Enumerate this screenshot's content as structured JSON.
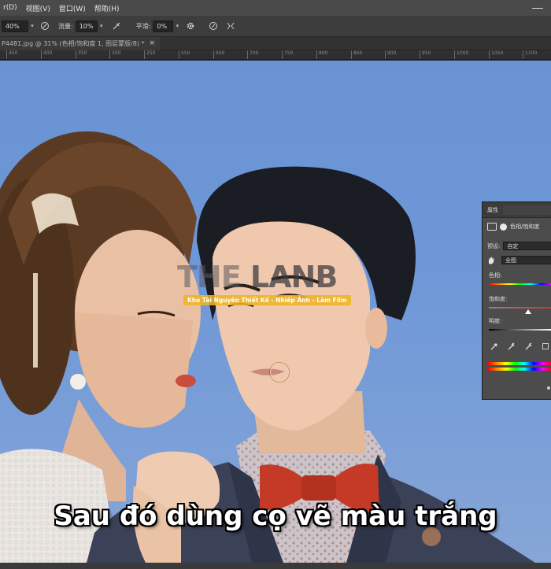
{
  "menu": {
    "items": [
      "r(D)",
      "视图(V)",
      "窗口(W)",
      "帮助(H)"
    ]
  },
  "options": {
    "size_value": "40%",
    "flow_label": "流量:",
    "flow_value": "10%",
    "smooth_label": "平滑:",
    "smooth_value": "0%"
  },
  "document": {
    "tab_title": "P4481.jpg @ 31% (色相/饱和度 1, 图层蒙版/8) *",
    "close_glyph": "×"
  },
  "ruler": {
    "ticks": [
      "450",
      "400",
      "350",
      "300",
      "250",
      "550",
      "650",
      "700",
      "750",
      "800",
      "850",
      "900",
      "950",
      "1000",
      "1050",
      "1100"
    ]
  },
  "watermark": {
    "main": "THE LANB",
    "the": "THE",
    "lanb": "LANB",
    "sub": "Kho Tài Nguyên Thiết Kế - Nhiếp Ảnh - Làm Film"
  },
  "subtitle": "Sau đó dùng cọ vẽ màu trắng",
  "properties": {
    "title": "属性",
    "adjustment_name": "色相/饱和度",
    "preset_label": "预设:",
    "preset_value": "自定",
    "channel_value": "全图",
    "hue_label": "色相:",
    "saturation_label": "饱和度:",
    "lightness_label": "明度:",
    "saturation_level": 0.62,
    "lightness_level": 0.5
  },
  "colors": {
    "menubar_bg": "#4a4a4a",
    "options_bg": "#3d3d3d",
    "panel_bg": "#4c4c4c",
    "sky_blue": "#6d97d7",
    "watermark_yellow": "#eeb428",
    "bowtie_red": "#c43a26"
  }
}
